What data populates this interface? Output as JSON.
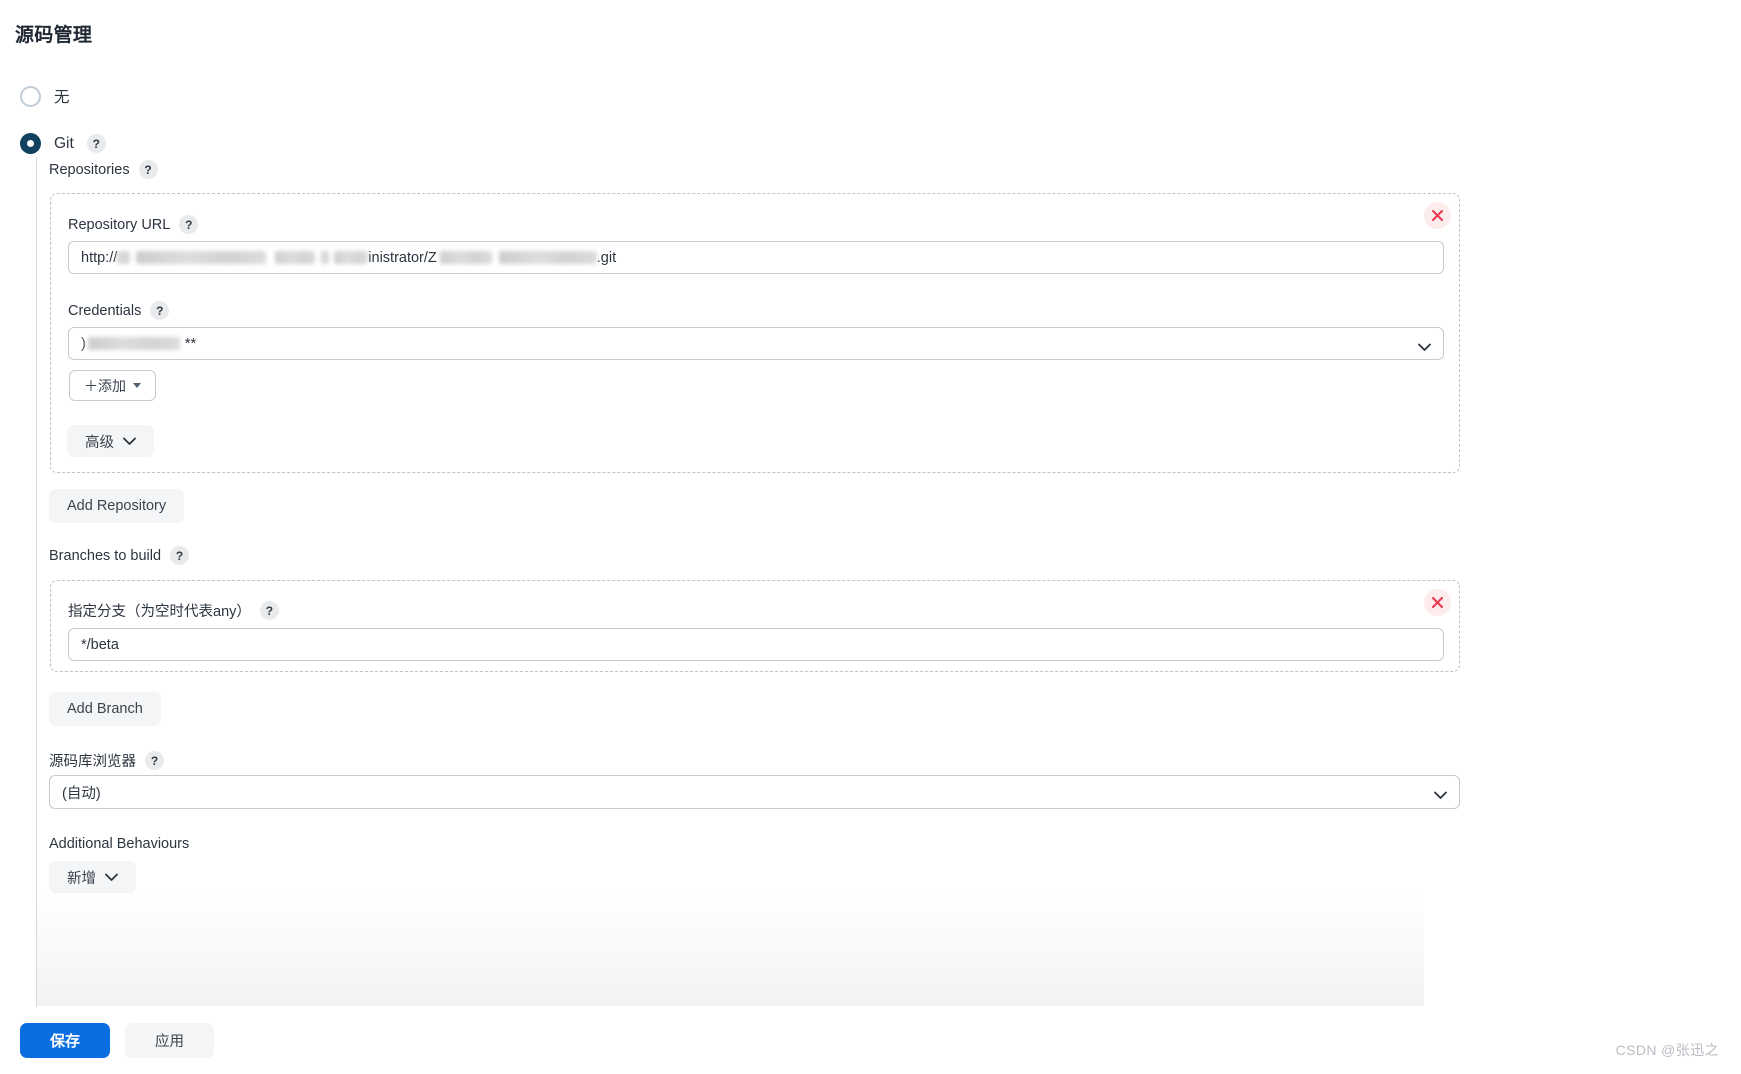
{
  "page": {
    "title": "源码管理",
    "watermark": "CSDN @张迅之"
  },
  "scm_options": [
    {
      "label": "无",
      "selected": false,
      "has_help": false
    },
    {
      "label": "Git",
      "selected": true,
      "has_help": true
    }
  ],
  "git": {
    "repositories_label": "Repositories",
    "repository": {
      "url_label": "Repository URL",
      "url_prefix": "http://",
      "url_middle": "inistrator/Z",
      "url_suffix": ".git",
      "credentials_label": "Credentials",
      "credentials_value_suffix": "**",
      "add_credentials_button": "＋添加",
      "advanced_button": "高级"
    },
    "add_repository_button": "Add Repository",
    "branches_label": "Branches to build",
    "branch": {
      "spec_label": "指定分支（为空时代表any）",
      "spec_value": "*/beta"
    },
    "add_branch_button": "Add Branch",
    "browser_label": "源码库浏览器",
    "browser_value": "(自动)",
    "additional_behaviours_label": "Additional Behaviours",
    "additional_behaviours_button": "新增"
  },
  "footer": {
    "save_button": "保存",
    "apply_button": "应用"
  },
  "icons": {
    "help": "?",
    "close": "×",
    "chevron_down": "⌄"
  },
  "colors": {
    "primary": "#0b6ee0",
    "radio_checked": "#12415f",
    "delete_bg": "#fdecec",
    "delete_fg": "#e8384f",
    "dashed_border": "#b9c4cd",
    "input_border": "#c2cdd4",
    "grey_button_bg": "#f4f5f7"
  }
}
